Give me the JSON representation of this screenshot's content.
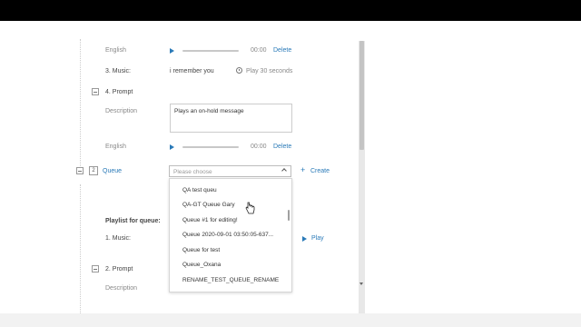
{
  "rows": {
    "english_1": {
      "label": "English",
      "time": "00:00",
      "delete": "Delete"
    },
    "music_3": {
      "label": "3. Music:",
      "value": "i remember you",
      "play_duration": "Play 30 seconds"
    },
    "prompt_4": {
      "label": "4. Prompt"
    },
    "description": {
      "label": "Description",
      "text": "Plays an on-hold message"
    },
    "english_2": {
      "label": "English",
      "time": "00:00",
      "delete": "Delete"
    },
    "queue": {
      "number": "2",
      "label": "Queue",
      "placeholder": "Please choose",
      "create": "Create"
    },
    "playlist": {
      "label": "Playlist for queue:"
    },
    "music_1": {
      "label": "1. Music:",
      "play": "Play"
    },
    "prompt_2": {
      "label": "2. Prompt"
    },
    "description_2": {
      "label": "Description"
    }
  },
  "dropdown": {
    "options": [
      "QA test queu",
      "QA-GT Queue Gary",
      "Queue #1 for editing!",
      "Queue 2020-09-01 03:50:05-637...",
      "Queue for test",
      "Queue_Oxana",
      "RENAME_TEST_QUEUE_RENAME"
    ]
  },
  "colors": {
    "accent": "#2a7ab8",
    "text": "#333333",
    "muted": "#888888"
  },
  "icons": [
    "play-icon",
    "clock-icon",
    "plus-icon",
    "chevron-up-icon",
    "minus-toggle-icon",
    "cursor-hand-icon"
  ]
}
